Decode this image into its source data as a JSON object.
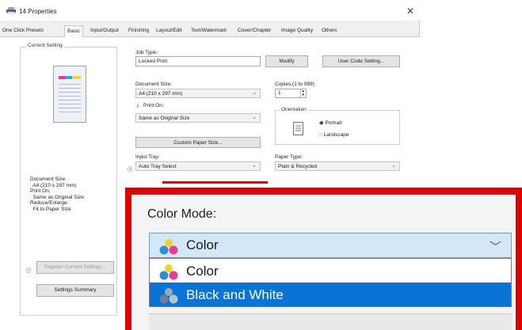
{
  "window": {
    "title": "14 Properties",
    "close_glyph": "✕"
  },
  "tabs": [
    "One Click Presets",
    "Basic",
    "Input/Output",
    "Finishing",
    "Layout/Edit",
    "Text/Watermark",
    "Cover/Chapter",
    "Image Quality",
    "Others"
  ],
  "active_tab": "Basic",
  "current_setting": {
    "title": "Current Setting",
    "summary": "Document Size:\n  A4 (210 x 297 mm)\nPrint On:\n  Same as Original Size\nReduce/Enlarge:\n  Fit to Paper Size"
  },
  "job_type": {
    "label": "Job Type:",
    "value": "Locked Print",
    "modify": "Modify",
    "user_code": "User Code Setting..."
  },
  "document_size": {
    "label": "Document Size:",
    "value": "A4 (210 x 297 mm)"
  },
  "copies": {
    "label": "Copies:(1 to 999)",
    "value": "1"
  },
  "print_on": {
    "label": "Print On:",
    "value": "Same as Original Size"
  },
  "orientation": {
    "label": "Orientation",
    "portrait": "Portrait",
    "landscape": "Landscape",
    "selected": "Portrait"
  },
  "custom_paper_size": "Custom Paper Size...",
  "input_tray": {
    "label": "Input Tray:",
    "value": "Auto Tray Select"
  },
  "paper_type": {
    "label": "Paper Type:",
    "value": "Plain & Recycled"
  },
  "register_button": "Register Current Settings...",
  "summary_button": "Settings Summary",
  "color_mode_zoom": {
    "label": "Color Mode:",
    "selected": "Color",
    "options": [
      "Color",
      "Black and White"
    ],
    "highlighted": "Black and White"
  },
  "colors": {
    "zoom_frame": "#e00000",
    "highlight": "#0a74d6",
    "combo_bg": "#d3e7f7"
  },
  "icons": {
    "title": "printer-icon",
    "info": "info-icon",
    "print_on": "arrow-down-icon",
    "color": "color-dots-icon",
    "bw": "bw-dots-icon"
  }
}
